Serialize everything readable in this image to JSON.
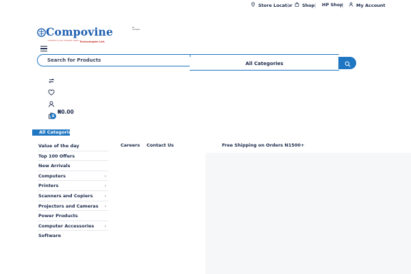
{
  "topbar": {
    "links": [
      {
        "label": "Store Locator",
        "icon": "map-pin-icon"
      },
      {
        "label": "Shop",
        "icon": "shopping-bag-icon"
      },
      {
        "label": "HP Shop",
        "icon": ""
      },
      {
        "label": "My Account",
        "icon": "user-icon"
      }
    ]
  },
  "logo": {
    "name": "Compovine",
    "subtitle": "Technologies Ltd.",
    "tagline": "...solutions to your Computer needs",
    "trademark": "RC 1234567"
  },
  "search": {
    "placeholder": "Search for Products",
    "category": "All Categories",
    "button_icon": "search-icon"
  },
  "header_icons": [
    "compare-icon",
    "heart-icon",
    "user-icon",
    "cart-icon"
  ],
  "cart": {
    "amount": "₦0.00",
    "count": "0"
  },
  "categories": {
    "header": "All Categories",
    "items": [
      {
        "label": "Value of the day",
        "has_children": false
      },
      {
        "label": "Top 100 Offers",
        "has_children": false
      },
      {
        "label": "New Arrivals",
        "has_children": false
      },
      {
        "label": "Computers",
        "has_children": true
      },
      {
        "label": "Printers",
        "has_children": true
      },
      {
        "label": "Scanners and Copiers",
        "has_children": true
      },
      {
        "label": "Projectors and Cameras",
        "has_children": true
      },
      {
        "label": "Power Products",
        "has_children": false
      },
      {
        "label": "Computer Accessories",
        "has_children": true
      },
      {
        "label": "Software",
        "has_children": false
      }
    ]
  },
  "nav": {
    "links": [
      "Careers",
      "Contact Us"
    ]
  },
  "promo": "Free Shipping on Orders N1500+",
  "colors": {
    "accent": "#1f76c2",
    "text": "#1c2a4a",
    "brand_red": "#c8342a"
  }
}
